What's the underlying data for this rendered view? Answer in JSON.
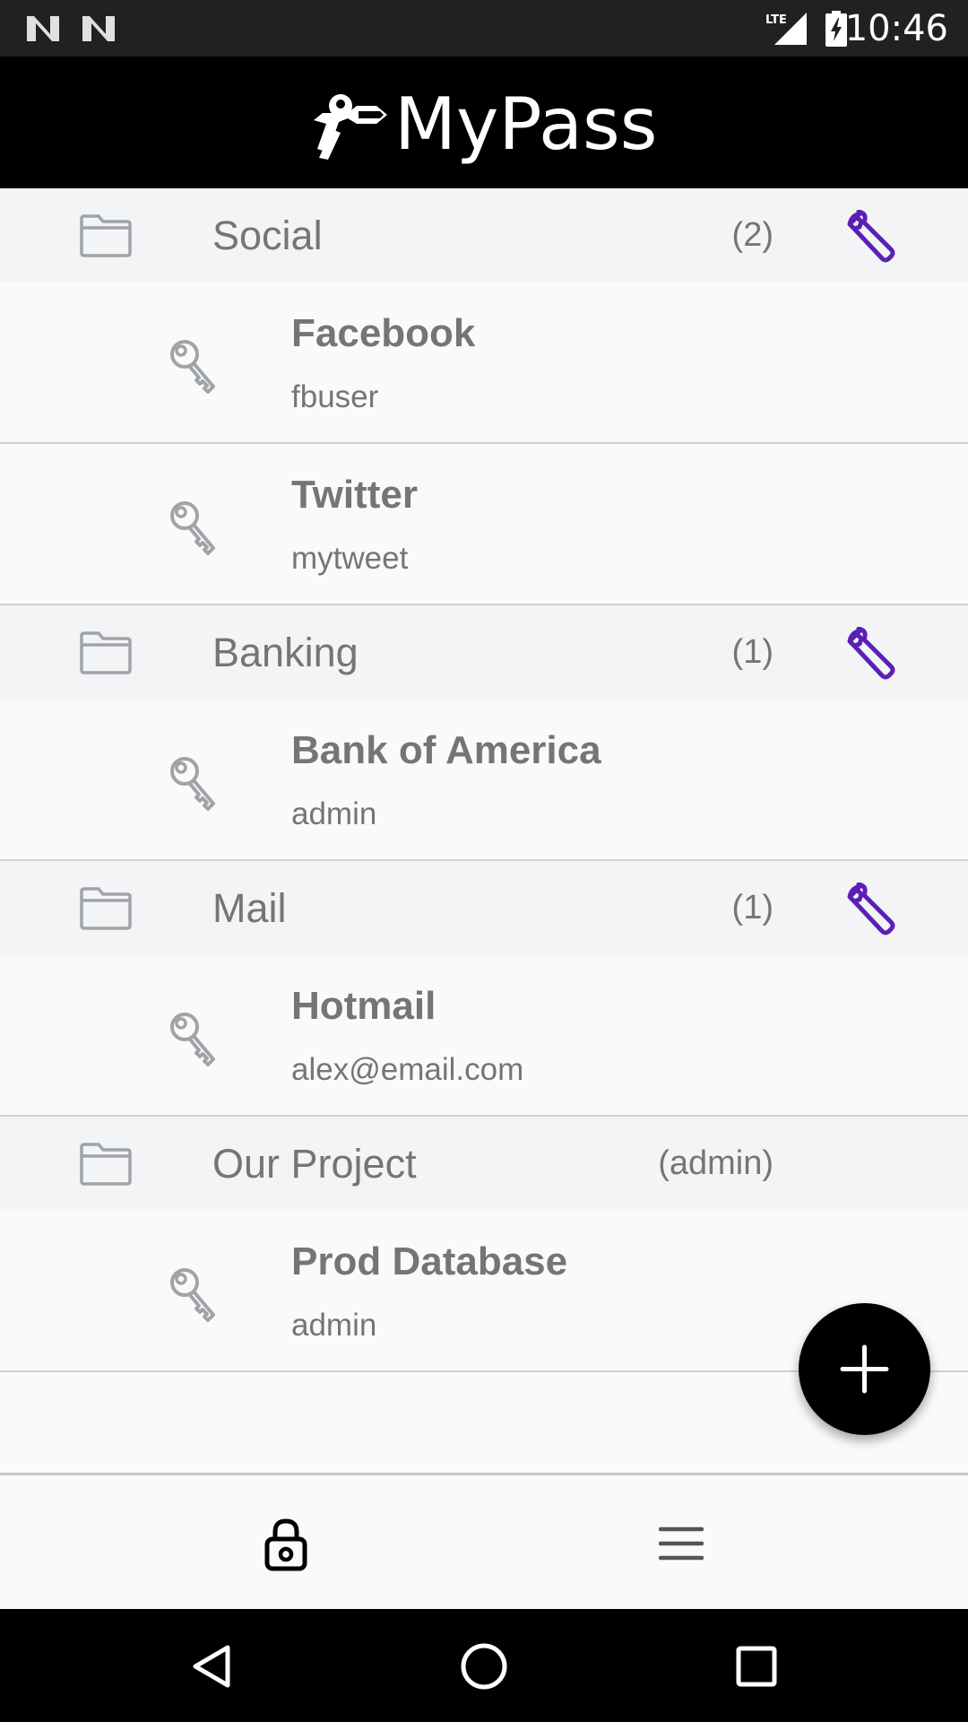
{
  "status_bar": {
    "time": "10:46",
    "network": "LTE",
    "notification_icons": [
      "n-icon",
      "n-icon"
    ],
    "icons": [
      "lte-signal-icon",
      "battery-charging-icon"
    ]
  },
  "header": {
    "title": "MyPass",
    "logo_icon": "keys-logo-icon"
  },
  "groups": [
    {
      "name": "Social",
      "count": "(2)",
      "has_settings": true,
      "entries": [
        {
          "title": "Facebook",
          "username": "fbuser"
        },
        {
          "title": "Twitter",
          "username": "mytweet"
        }
      ]
    },
    {
      "name": "Banking",
      "count": "(1)",
      "has_settings": true,
      "entries": [
        {
          "title": "Bank of America",
          "username": "admin"
        }
      ]
    },
    {
      "name": "Mail",
      "count": "(1)",
      "has_settings": true,
      "entries": [
        {
          "title": "Hotmail",
          "username": "alex@email.com"
        }
      ]
    },
    {
      "name": "Our Project",
      "count": "(admin)",
      "has_settings": false,
      "entries": [
        {
          "title": "Prod Database",
          "username": "admin"
        }
      ]
    }
  ],
  "fab": {
    "icon": "plus-icon"
  },
  "bottom_nav": {
    "items": [
      {
        "icon": "lock-icon",
        "active": true
      },
      {
        "icon": "menu-icon",
        "active": false
      }
    ]
  },
  "system_nav": {
    "icons": [
      "back-icon",
      "home-icon",
      "recents-icon"
    ]
  },
  "colors": {
    "accent": "#5b1fb5",
    "header_bg": "#000000",
    "group_bg": "#f3f4f6",
    "text_gray": "#757575",
    "icon_gray": "#a0a4a8"
  }
}
